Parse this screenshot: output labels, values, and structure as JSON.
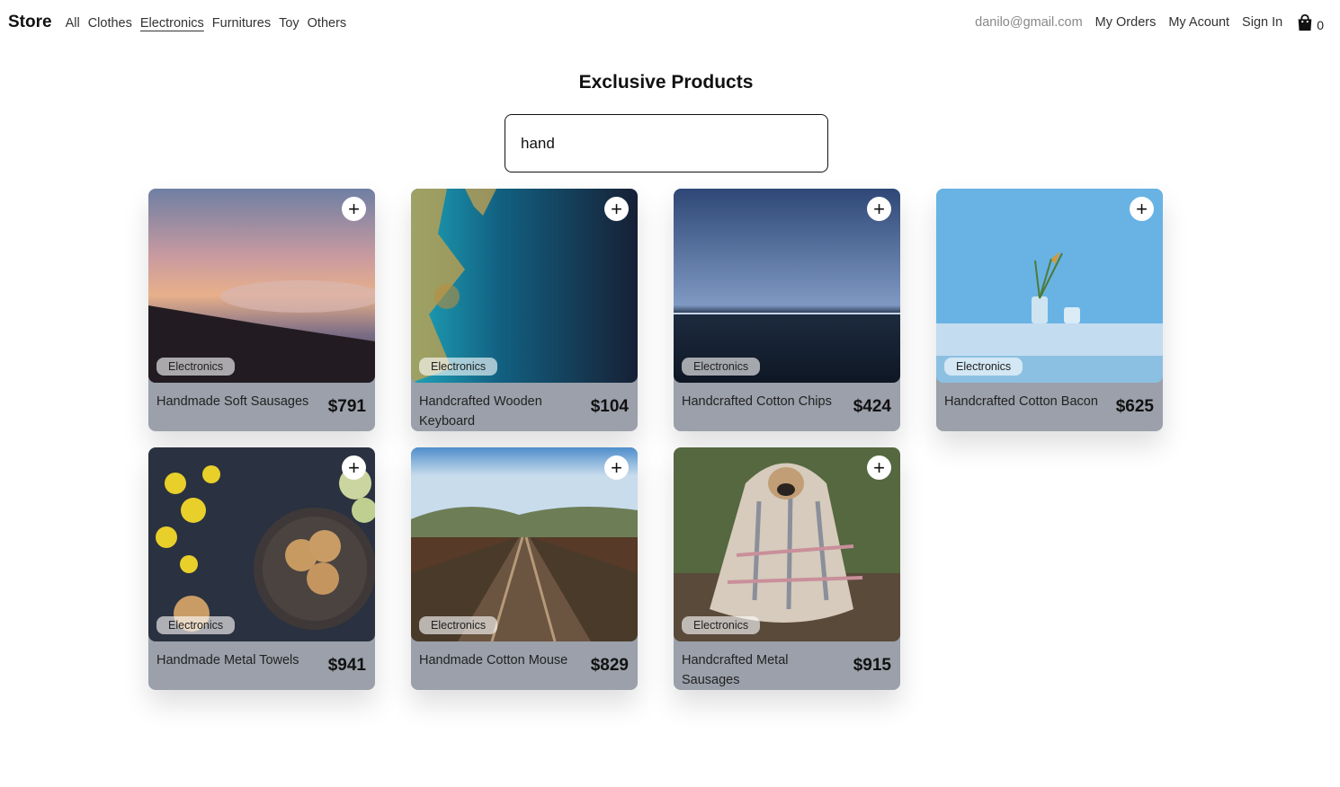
{
  "nav": {
    "brand": "Store",
    "categories": [
      "All",
      "Clothes",
      "Electronics",
      "Furnitures",
      "Toy",
      "Others"
    ],
    "active_category": "Electronics",
    "email": "danilo@gmail.com",
    "my_orders": "My Orders",
    "my_account": "My Acount",
    "sign_in": "Sign In",
    "cart_icon": "shopping-bag-icon",
    "cart_count": "0"
  },
  "page": {
    "title": "Exclusive Products",
    "search_value": "hand"
  },
  "products": [
    {
      "name": "Handmade Soft Sausages",
      "price": "$791",
      "category": "Electronics",
      "image": "sunset-mountain"
    },
    {
      "name": "Handcrafted Wooden Keyboard",
      "price": "$104",
      "category": "Electronics",
      "image": "aerial-ocean"
    },
    {
      "name": "Handcrafted Cotton Chips",
      "price": "$424",
      "category": "Electronics",
      "image": "calm-sea"
    },
    {
      "name": "Handcrafted Cotton Bacon",
      "price": "$625",
      "category": "Electronics",
      "image": "blue-wall-plant"
    },
    {
      "name": "Handmade Metal Towels",
      "price": "$941",
      "category": "Electronics",
      "image": "cookies-flowers"
    },
    {
      "name": "Handmade Cotton Mouse",
      "price": "$829",
      "category": "Electronics",
      "image": "railway-bridge"
    },
    {
      "name": "Handcrafted Metal Sausages",
      "price": "$915",
      "category": "Electronics",
      "image": "pug-blanket"
    }
  ],
  "add_button_label": "+",
  "colors": {
    "card_bg": "#9ba0aa",
    "accent": "#111111"
  }
}
